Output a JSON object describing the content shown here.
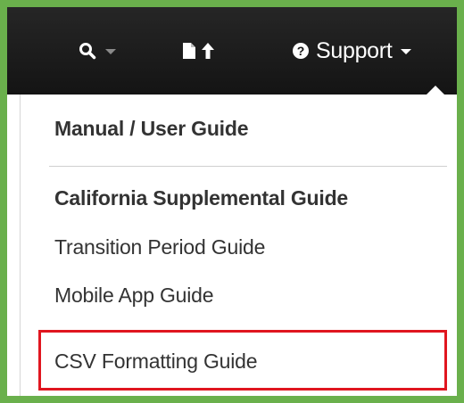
{
  "navbar": {
    "search_icon": "search-icon",
    "upload_icon": "file-upload-icon",
    "support_icon": "question-circle-icon",
    "support_label": "Support"
  },
  "menu": {
    "items": [
      {
        "label": "Manual / User Guide",
        "bold": true
      },
      {
        "label": "California Supplemental Guide",
        "bold": true
      },
      {
        "label": "Transition Period Guide",
        "bold": false
      },
      {
        "label": "Mobile App Guide",
        "bold": false
      },
      {
        "label": "CSV Formatting Guide",
        "bold": false,
        "highlighted": true
      }
    ]
  },
  "colors": {
    "frame_border": "#6ab04c",
    "navbar_bg": "#1a1a1a",
    "highlight_border": "#e0161f",
    "menu_text": "#333333"
  }
}
